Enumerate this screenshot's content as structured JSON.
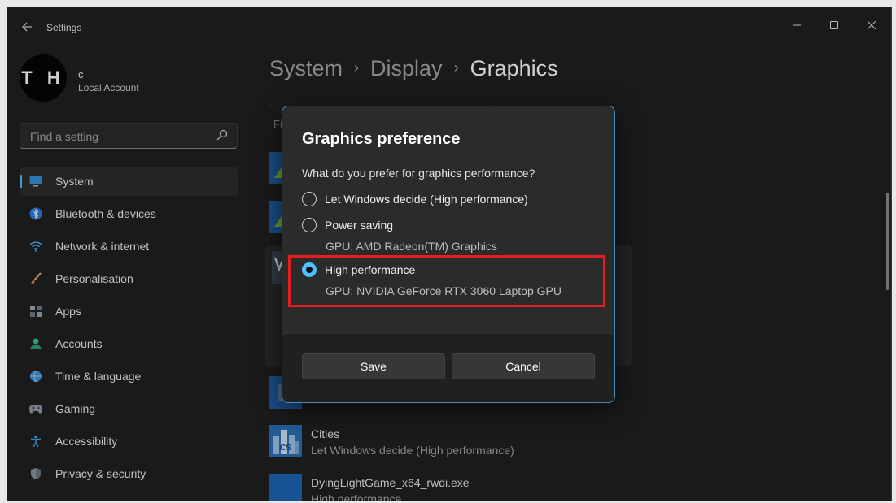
{
  "window": {
    "title": "Settings"
  },
  "user": {
    "initials": "T H",
    "name": "c",
    "account_type": "Local Account"
  },
  "search": {
    "placeholder": "Find a setting"
  },
  "sidebar": {
    "items": [
      {
        "label": "System",
        "icon": "monitor-icon",
        "active": true
      },
      {
        "label": "Bluetooth & devices",
        "icon": "bluetooth-icon"
      },
      {
        "label": "Network & internet",
        "icon": "wifi-icon"
      },
      {
        "label": "Personalisation",
        "icon": "brush-icon"
      },
      {
        "label": "Apps",
        "icon": "apps-icon"
      },
      {
        "label": "Accounts",
        "icon": "person-icon"
      },
      {
        "label": "Time & language",
        "icon": "globe-clock-icon"
      },
      {
        "label": "Gaming",
        "icon": "gamepad-icon"
      },
      {
        "label": "Accessibility",
        "icon": "accessibility-icon"
      },
      {
        "label": "Privacy & security",
        "icon": "shield-icon"
      }
    ]
  },
  "breadcrumb": {
    "items": [
      "System",
      "Display",
      "Graphics"
    ],
    "separator": "›"
  },
  "background": {
    "filter_label": "Fi",
    "apps": [
      {
        "name": "Cities",
        "preference": "Let Windows decide (High performance)"
      },
      {
        "name": "DyingLightGame_x64_rwdi.exe",
        "preference": "High performance"
      }
    ]
  },
  "dialog": {
    "title": "Graphics preference",
    "question": "What do you prefer for graphics performance?",
    "options": [
      {
        "label": "Let Windows decide (High performance)",
        "checked": false
      },
      {
        "label": "Power saving",
        "gpu": "GPU: AMD Radeon(TM) Graphics",
        "checked": false
      },
      {
        "label": "High performance",
        "gpu": "GPU: NVIDIA GeForce RTX 3060 Laptop GPU",
        "checked": true
      }
    ],
    "save_label": "Save",
    "cancel_label": "Cancel"
  },
  "colors": {
    "accent": "#4cc2ff",
    "highlight": "#e31e24",
    "background": "#202020",
    "dialog": "#2b2b2b"
  }
}
